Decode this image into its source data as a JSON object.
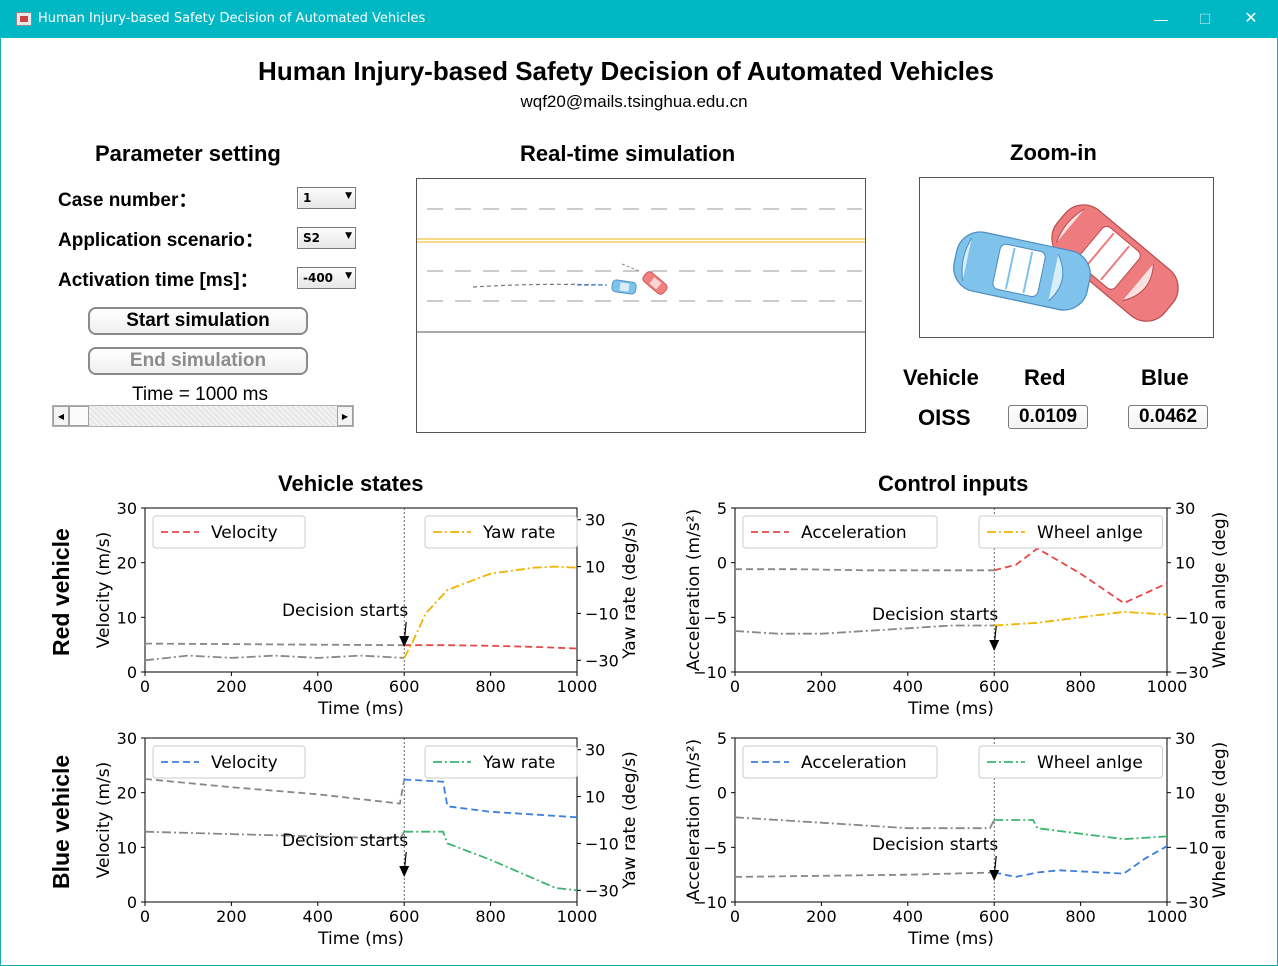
{
  "window": {
    "title": "Human Injury-based Safety Decision of Automated Vehicles",
    "minimize_icon": "minimize-icon",
    "maximize_icon": "maximize-icon",
    "close_icon": "close-icon"
  },
  "header": {
    "title": "Human Injury-based Safety Decision of Automated Vehicles",
    "email": "wqf20@mails.tsinghua.edu.cn"
  },
  "param": {
    "title": "Parameter setting",
    "case_label": "Case number：",
    "case_value": "1",
    "scenario_label": "Application scenario：",
    "scenario_value": "S2",
    "activation_label": "Activation time [ms]：",
    "activation_value": "-400",
    "start_label": "Start simulation",
    "end_label": "End simulation",
    "time_label": "Time = 1000 ms",
    "slider_level": 0.0
  },
  "sim": {
    "title": "Real-time simulation"
  },
  "zoom": {
    "title": "Zoom-in"
  },
  "oiss": {
    "vehicle_label": "Vehicle",
    "red_label": "Red",
    "blue_label": "Blue",
    "oiss_label": "OISS",
    "red_value": "0.0109",
    "blue_value": "0.0462"
  },
  "sections": {
    "vehicle_states": "Vehicle states",
    "control_inputs": "Control inputs",
    "red_vehicle": "Red vehicle",
    "blue_vehicle": "Blue vehicle"
  },
  "colors": {
    "red": "#e8474a",
    "blue": "#3d7fe0",
    "orange": "#f0b400",
    "green": "#3cb56e",
    "gray": "#888888",
    "titlebar": "#00b7c3"
  },
  "chart_data": [
    {
      "id": "red-states",
      "type": "line",
      "xlabel": "Time (ms)",
      "ylabel": "Velocity (m/s)",
      "y2label": "Yaw rate (deg/s)",
      "xlim": [
        0,
        1000
      ],
      "ylim": [
        0,
        30
      ],
      "y2lim": [
        -35,
        35
      ],
      "xticks": [
        "0",
        "200",
        "400",
        "600",
        "800",
        "1000"
      ],
      "yticks": [
        "0",
        "10",
        "20",
        "30"
      ],
      "y2ticks": [
        "−30",
        "−10",
        "10",
        "30"
      ],
      "annotation": "Decision starts",
      "legend": [
        "Velocity",
        "Yaw rate"
      ],
      "series": [
        {
          "name": "Velocity",
          "axis": "y",
          "color": "#e8474a",
          "style": "dashed",
          "before_color": "#888888",
          "x": [
            0,
            200,
            400,
            600,
            700,
            800,
            900,
            1000
          ],
          "values": [
            5.2,
            5.1,
            5.0,
            4.9,
            4.9,
            4.8,
            4.6,
            4.3
          ]
        },
        {
          "name": "Yaw rate",
          "axis": "y2",
          "color": "#f0b400",
          "style": "dashdot",
          "before_color": "#888888",
          "x": [
            0,
            100,
            200,
            300,
            400,
            500,
            600,
            620,
            650,
            700,
            800,
            900,
            950,
            1000
          ],
          "values": [
            -30,
            -28,
            -29,
            -28,
            -29,
            -28,
            -29,
            -22,
            -10,
            0,
            7,
            9.5,
            10,
            9.5
          ]
        }
      ]
    },
    {
      "id": "red-controls",
      "type": "line",
      "xlabel": "Time (ms)",
      "ylabel": "Acceleration (m/s²)",
      "y2label": "Wheel anlge (deg)",
      "xlim": [
        0,
        1000
      ],
      "ylim": [
        -10,
        5
      ],
      "y2lim": [
        -30,
        30
      ],
      "xticks": [
        "0",
        "200",
        "400",
        "600",
        "800",
        "1000"
      ],
      "yticks": [
        "−10",
        "−5",
        "0",
        "5"
      ],
      "y2ticks": [
        "−30",
        "−10",
        "10",
        "30"
      ],
      "annotation": "Decision starts",
      "legend": [
        "Acceleration",
        "Wheel anlge"
      ],
      "series": [
        {
          "name": "Acceleration",
          "axis": "y",
          "color": "#e8474a",
          "style": "dashed",
          "before_color": "#888888",
          "x": [
            0,
            150,
            300,
            450,
            600,
            620,
            650,
            700,
            800,
            900,
            1000
          ],
          "values": [
            -0.6,
            -0.6,
            -0.7,
            -0.7,
            -0.7,
            -0.5,
            -0.2,
            1.3,
            -1.0,
            -3.7,
            -1.9
          ]
        },
        {
          "name": "Wheel anlge",
          "axis": "y2",
          "color": "#f0b400",
          "style": "dashdot",
          "before_color": "#888888",
          "x": [
            0,
            100,
            200,
            300,
            400,
            500,
            600,
            700,
            800,
            900,
            1000
          ],
          "values": [
            -15,
            -16,
            -16,
            -15,
            -14,
            -13,
            -13,
            -12,
            -10,
            -8,
            -9
          ]
        }
      ]
    },
    {
      "id": "blue-states",
      "type": "line",
      "xlabel": "Time (ms)",
      "ylabel": "Velocity (m/s)",
      "y2label": "Yaw rate (deg/s)",
      "xlim": [
        0,
        1000
      ],
      "ylim": [
        0,
        30
      ],
      "y2lim": [
        -35,
        35
      ],
      "xticks": [
        "0",
        "200",
        "400",
        "600",
        "800",
        "1000"
      ],
      "yticks": [
        "0",
        "10",
        "20",
        "30"
      ],
      "y2ticks": [
        "−30",
        "−10",
        "10",
        "30"
      ],
      "annotation": "Decision starts",
      "legend": [
        "Velocity",
        "Yaw rate"
      ],
      "series": [
        {
          "name": "Velocity",
          "axis": "y",
          "color": "#3d7fe0",
          "style": "dashed",
          "before_color": "#888888",
          "x": [
            0,
            200,
            400,
            590,
            600,
            690,
            700,
            800,
            900,
            1000
          ],
          "values": [
            22.5,
            21,
            19.7,
            18,
            22.4,
            22,
            17.5,
            16.5,
            16,
            15.5
          ]
        },
        {
          "name": "Yaw rate",
          "axis": "y2",
          "color": "#3cb56e",
          "style": "dashdot",
          "before_color": "#888888",
          "x": [
            0,
            200,
            400,
            590,
            600,
            690,
            700,
            800,
            900,
            950,
            1000
          ],
          "values": [
            -5,
            -6,
            -7,
            -8,
            -5,
            -5,
            -10,
            -17,
            -25,
            -29,
            -30
          ]
        }
      ]
    },
    {
      "id": "blue-controls",
      "type": "line",
      "xlabel": "Time (ms)",
      "ylabel": "Acceleration (m/s²)",
      "y2label": "Wheel anlge (deg)",
      "xlim": [
        0,
        1000
      ],
      "ylim": [
        -10,
        5
      ],
      "y2lim": [
        -30,
        30
      ],
      "xticks": [
        "0",
        "200",
        "400",
        "600",
        "800",
        "1000"
      ],
      "yticks": [
        "−10",
        "−5",
        "0",
        "5"
      ],
      "y2ticks": [
        "−30",
        "−10",
        "10",
        "30"
      ],
      "annotation": "Decision starts",
      "legend": [
        "Acceleration",
        "Wheel anlge"
      ],
      "series": [
        {
          "name": "Acceleration",
          "axis": "y",
          "color": "#3d7fe0",
          "style": "dashed",
          "before_color": "#888888",
          "x": [
            0,
            200,
            400,
            600,
            650,
            700,
            750,
            800,
            900,
            950,
            1000
          ],
          "values": [
            -7.7,
            -7.6,
            -7.5,
            -7.3,
            -7.7,
            -7.3,
            -7.1,
            -7.2,
            -7.4,
            -6.0,
            -4.9
          ]
        },
        {
          "name": "Wheel anlge",
          "axis": "y2",
          "color": "#3cb56e",
          "style": "dashdot",
          "before_color": "#888888",
          "x": [
            0,
            200,
            400,
            590,
            600,
            690,
            700,
            800,
            900,
            1000
          ],
          "values": [
            1,
            -1,
            -3,
            -3,
            0,
            0,
            -3,
            -5,
            -7,
            -6
          ]
        }
      ]
    }
  ]
}
